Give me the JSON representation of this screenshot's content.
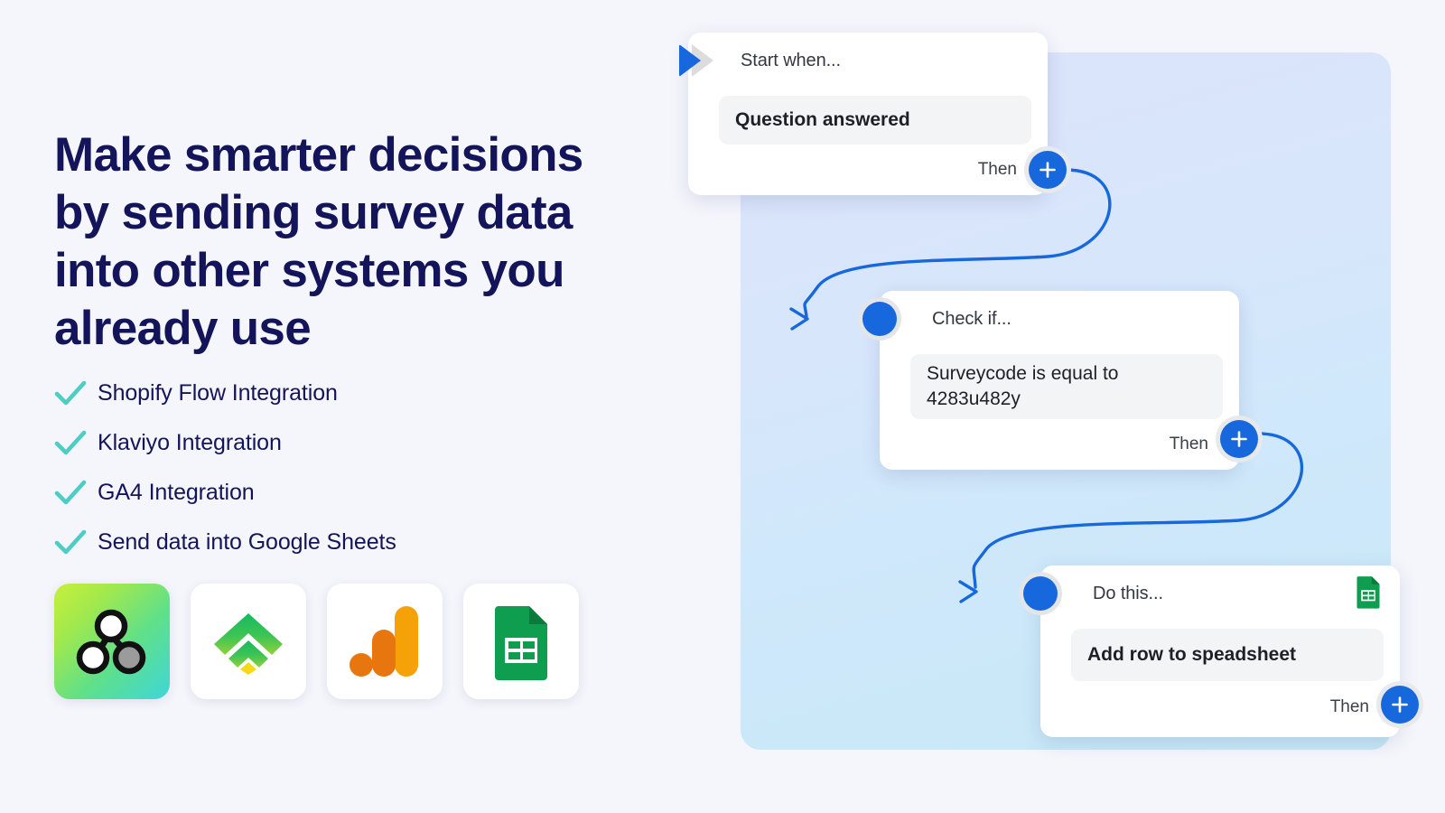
{
  "theme": {
    "background": "#f5f6fc",
    "heading_color": "#14145a",
    "check_color": "#4ecdc4",
    "accent_blue": "#1668dc",
    "stripe_pink": "#ec4899"
  },
  "hero": {
    "title": "Make smarter decisions by sending survey data into other systems you already use"
  },
  "features": [
    {
      "label": "Shopify Flow Integration",
      "icon": "check-icon"
    },
    {
      "label": "Klaviyo Integration",
      "icon": "check-icon"
    },
    {
      "label": "GA4 Integration",
      "icon": "check-icon"
    },
    {
      "label": "Send data into Google Sheets",
      "icon": "check-icon"
    }
  ],
  "logos": [
    {
      "name": "shopify-flow-logo",
      "label": "Shopify Flow"
    },
    {
      "name": "klaviyo-logo",
      "label": "Klaviyo"
    },
    {
      "name": "google-analytics-logo",
      "label": "Google Analytics"
    },
    {
      "name": "google-sheets-logo",
      "label": "Google Sheets"
    }
  ],
  "flow": {
    "cards": [
      {
        "id": "trigger",
        "header": "Start when...",
        "header_icon": "play-triangle-icon",
        "chip": "Question answered",
        "chip_bold": true,
        "footer_label": "Then",
        "add_button": "add-step-button"
      },
      {
        "id": "condition",
        "header": "Check if...",
        "header_icon": "node-dot-icon",
        "chip": "Surveycode is equal to 4283u482y",
        "chip_bold": false,
        "footer_label": "Then",
        "add_button": "add-step-button"
      },
      {
        "id": "action",
        "header": "Do this...",
        "header_icon": "node-dot-icon",
        "chip": "Add row to speadsheet",
        "chip_bold": true,
        "footer_label": "Then",
        "add_button": "add-step-button",
        "app_icon": "google-sheets-icon"
      }
    ]
  }
}
